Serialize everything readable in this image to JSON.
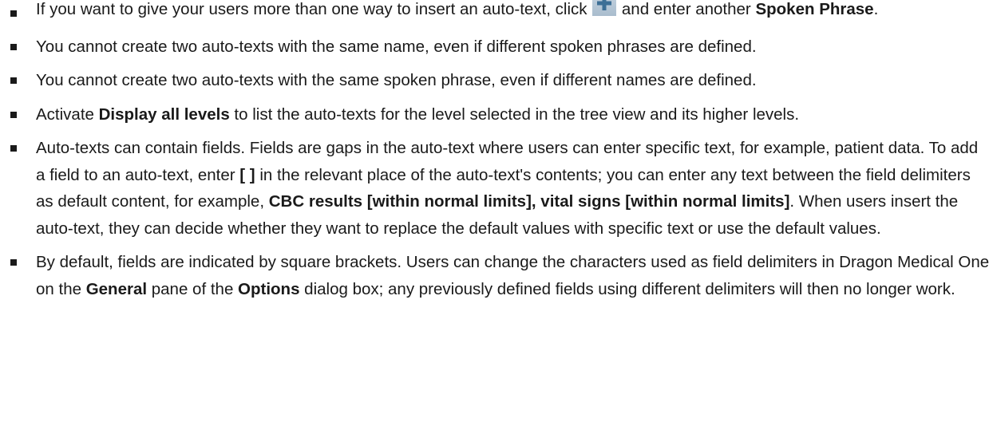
{
  "notes": [
    {
      "parts": [
        "If you want to give your users more than one way to insert an auto-text, click ",
        "and enter another ",
        "Spoken Phrase",
        "."
      ],
      "icon": "plus-icon"
    },
    {
      "text": "You cannot create two auto-texts with the same name, even if different spoken phrases are defined."
    },
    {
      "text": "You cannot create two auto-texts with the same spoken phrase, even if different names are defined."
    },
    {
      "parts": [
        "Activate ",
        "Display all levels",
        " to list the auto-texts for the level selected in the tree view and its higher levels."
      ]
    },
    {
      "parts": [
        "Auto-texts can contain fields. Fields are gaps in the auto-text where users can enter specific text, for example, patient data. To add a field to an auto-text, enter ",
        "[ ]",
        " in the relevant place of the auto-text's contents; you can enter any text between the field delimiters as default content, for example, ",
        "CBC results [within normal limits], vital signs [within normal limits]",
        ". When users insert the auto-text, they can decide whether they want to replace the default values with specific text or use the default values."
      ]
    },
    {
      "parts": [
        "By default, fields are indicated by square brackets. Users can change the characters used as field delimiters in Dragon Medical One on the ",
        "General",
        " pane of the ",
        "Options",
        " dialog box; any previously defined fields using different delimiters will then no longer work."
      ]
    }
  ],
  "colors": {
    "text": "#1a1a1a",
    "icon_bg_top": "#c4d3e0",
    "icon_bg_bottom": "#a9bccd",
    "icon_plus": "#3d6f96"
  }
}
